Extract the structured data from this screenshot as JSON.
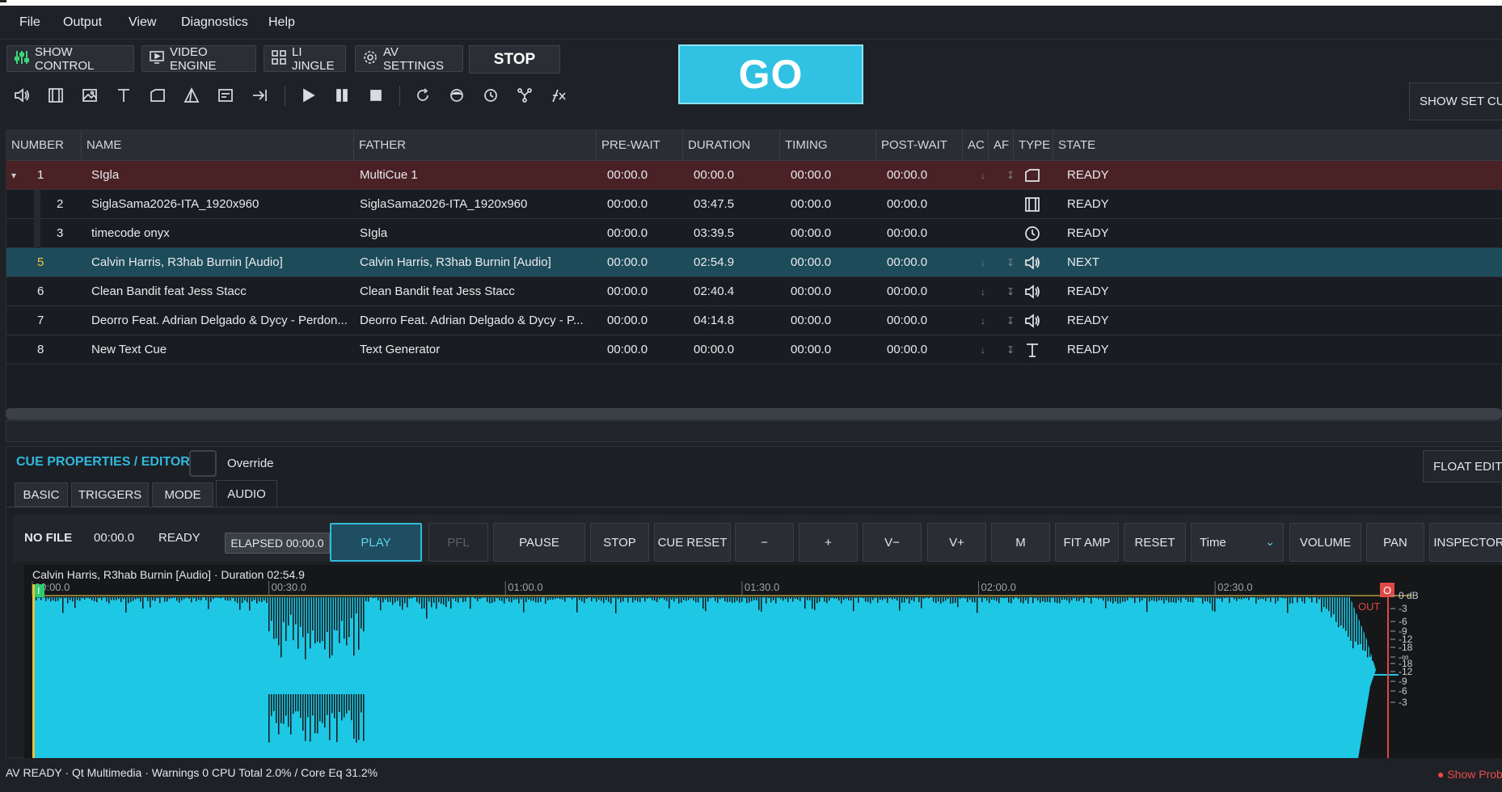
{
  "menu": [
    "File",
    "Output",
    "View",
    "Diagnostics",
    "Help"
  ],
  "toolbar": {
    "buttons": [
      {
        "label": "SHOW CONTROL",
        "icon": "sliders-icon"
      },
      {
        "label": "VIDEO ENGINE",
        "icon": "monitor-play-icon"
      },
      {
        "label": "LI JINGLE",
        "icon": "grid-icon"
      },
      {
        "label": "AV SETTINGS",
        "icon": "gear-icon"
      }
    ],
    "stop_label": "STOP",
    "go_label": "GO",
    "show_set_cue_label": "SHOW SET CUE"
  },
  "tool_icons": [
    "speaker-icon",
    "film-icon",
    "image-icon",
    "text-icon",
    "folder-icon",
    "triangle-icon",
    "note-icon",
    "arrow-right-bar-icon",
    "play-icon",
    "pause-icon",
    "stop-icon",
    "refresh-icon",
    "circle-icon",
    "clock-icon",
    "network-icon",
    "fx-icon"
  ],
  "table": {
    "columns": [
      "NUMBER",
      "NAME",
      "FATHER",
      "PRE-WAIT",
      "DURATION",
      "TIMING",
      "POST-WAIT",
      "AC",
      "AF",
      "TYPE",
      "STATE"
    ],
    "rows": [
      {
        "number": "1",
        "name": "SIgla",
        "father": "MultiCue 1",
        "prewait": "00:00.0",
        "duration": "00:00.0",
        "timing": "00:00.0",
        "postwait": "00:00.0",
        "ac": "↓",
        "af": "↧",
        "type": "folder-icon",
        "state": "READY",
        "style": "selected",
        "indent": 0,
        "expander": "▾"
      },
      {
        "number": "2",
        "name": "SiglaSama2026-ITA_1920x960",
        "father": "SiglaSama2026-ITA_1920x960",
        "prewait": "00:00.0",
        "duration": "03:47.5",
        "timing": "00:00.0",
        "postwait": "00:00.0",
        "ac": "",
        "af": "",
        "type": "film-icon",
        "state": "READY",
        "style": "normal",
        "indent": 1,
        "expander": ""
      },
      {
        "number": "3",
        "name": "timecode onyx",
        "father": "SIgla",
        "prewait": "00:00.0",
        "duration": "03:39.5",
        "timing": "00:00.0",
        "postwait": "00:00.0",
        "ac": "",
        "af": "",
        "type": "clock-icon",
        "state": "READY",
        "style": "normal",
        "indent": 1,
        "expander": ""
      },
      {
        "number": "5",
        "name": "Calvin Harris, R3hab   Burnin [Audio]",
        "father": "Calvin Harris, R3hab   Burnin [Audio]",
        "prewait": "00:00.0",
        "duration": "02:54.9",
        "timing": "00:00.0",
        "postwait": "00:00.0",
        "ac": "↓",
        "af": "↧",
        "type": "speaker-icon",
        "state": "NEXT",
        "style": "next",
        "indent": 0,
        "expander": ""
      },
      {
        "number": "6",
        "name": "Clean Bandit feat Jess Stacc",
        "father": "Clean Bandit feat Jess Stacc",
        "prewait": "00:00.0",
        "duration": "02:40.4",
        "timing": "00:00.0",
        "postwait": "00:00.0",
        "ac": "↓",
        "af": "↧",
        "type": "speaker-icon",
        "state": "READY",
        "style": "normal",
        "indent": 0,
        "expander": ""
      },
      {
        "number": "7",
        "name": "Deorro Feat. Adrian Delgado & Dycy - Perdon...",
        "father": "Deorro Feat. Adrian Delgado & Dycy - P...",
        "prewait": "00:00.0",
        "duration": "04:14.8",
        "timing": "00:00.0",
        "postwait": "00:00.0",
        "ac": "↓",
        "af": "↧",
        "type": "speaker-icon",
        "state": "READY",
        "style": "normal",
        "indent": 0,
        "expander": ""
      },
      {
        "number": "8",
        "name": "New Text Cue",
        "father": "Text Generator",
        "prewait": "00:00.0",
        "duration": "00:00.0",
        "timing": "00:00.0",
        "postwait": "00:00.0",
        "ac": "↓",
        "af": "↧",
        "type": "text-icon",
        "state": "READY",
        "style": "normal",
        "indent": 0,
        "expander": ""
      }
    ]
  },
  "editor": {
    "title": "CUE PROPERTIES / EDITOR",
    "override_label": "Override",
    "float_editor_label": "FLOAT EDITOR",
    "tabs": [
      "BASIC",
      "TRIGGERS",
      "MODE",
      "AUDIO"
    ],
    "active_tab": "AUDIO",
    "file_label": "NO FILE",
    "time": "00:00.0",
    "state": "READY",
    "elapsed": "ELAPSED 00:00.0",
    "buttons": [
      "PLAY",
      "PFL",
      "PAUSE",
      "STOP",
      "CUE RESET",
      "−",
      "+",
      "V−",
      "V+",
      "M",
      "FIT AMP",
      "RESET"
    ],
    "time_select": "Time",
    "right_buttons": [
      "VOLUME",
      "PAN",
      "INSPECTOR"
    ],
    "waveform": {
      "caption": "Calvin Harris, R3hab   Burnin [Audio] · Duration 02:54.9",
      "time_marks": [
        "00:00.0",
        "00:30.0",
        "01:00.0",
        "01:30.0",
        "02:00.0",
        "02:30.0"
      ],
      "in_label": "I",
      "out_marker": "O",
      "out_label": "OUT",
      "db_scale": [
        "0 dB",
        "-3",
        "-6",
        "-9",
        "-12",
        "-18",
        "-∞",
        "-18",
        "-12",
        "-9",
        "-6",
        "-3"
      ],
      "color": "#1ec8e4",
      "bg": "#151719"
    }
  },
  "status": {
    "text": "AV READY · Qt Multimedia · Warnings 0 CPU Total 2.0% / Core Eq 31.2%",
    "right": "● Show Prob"
  }
}
